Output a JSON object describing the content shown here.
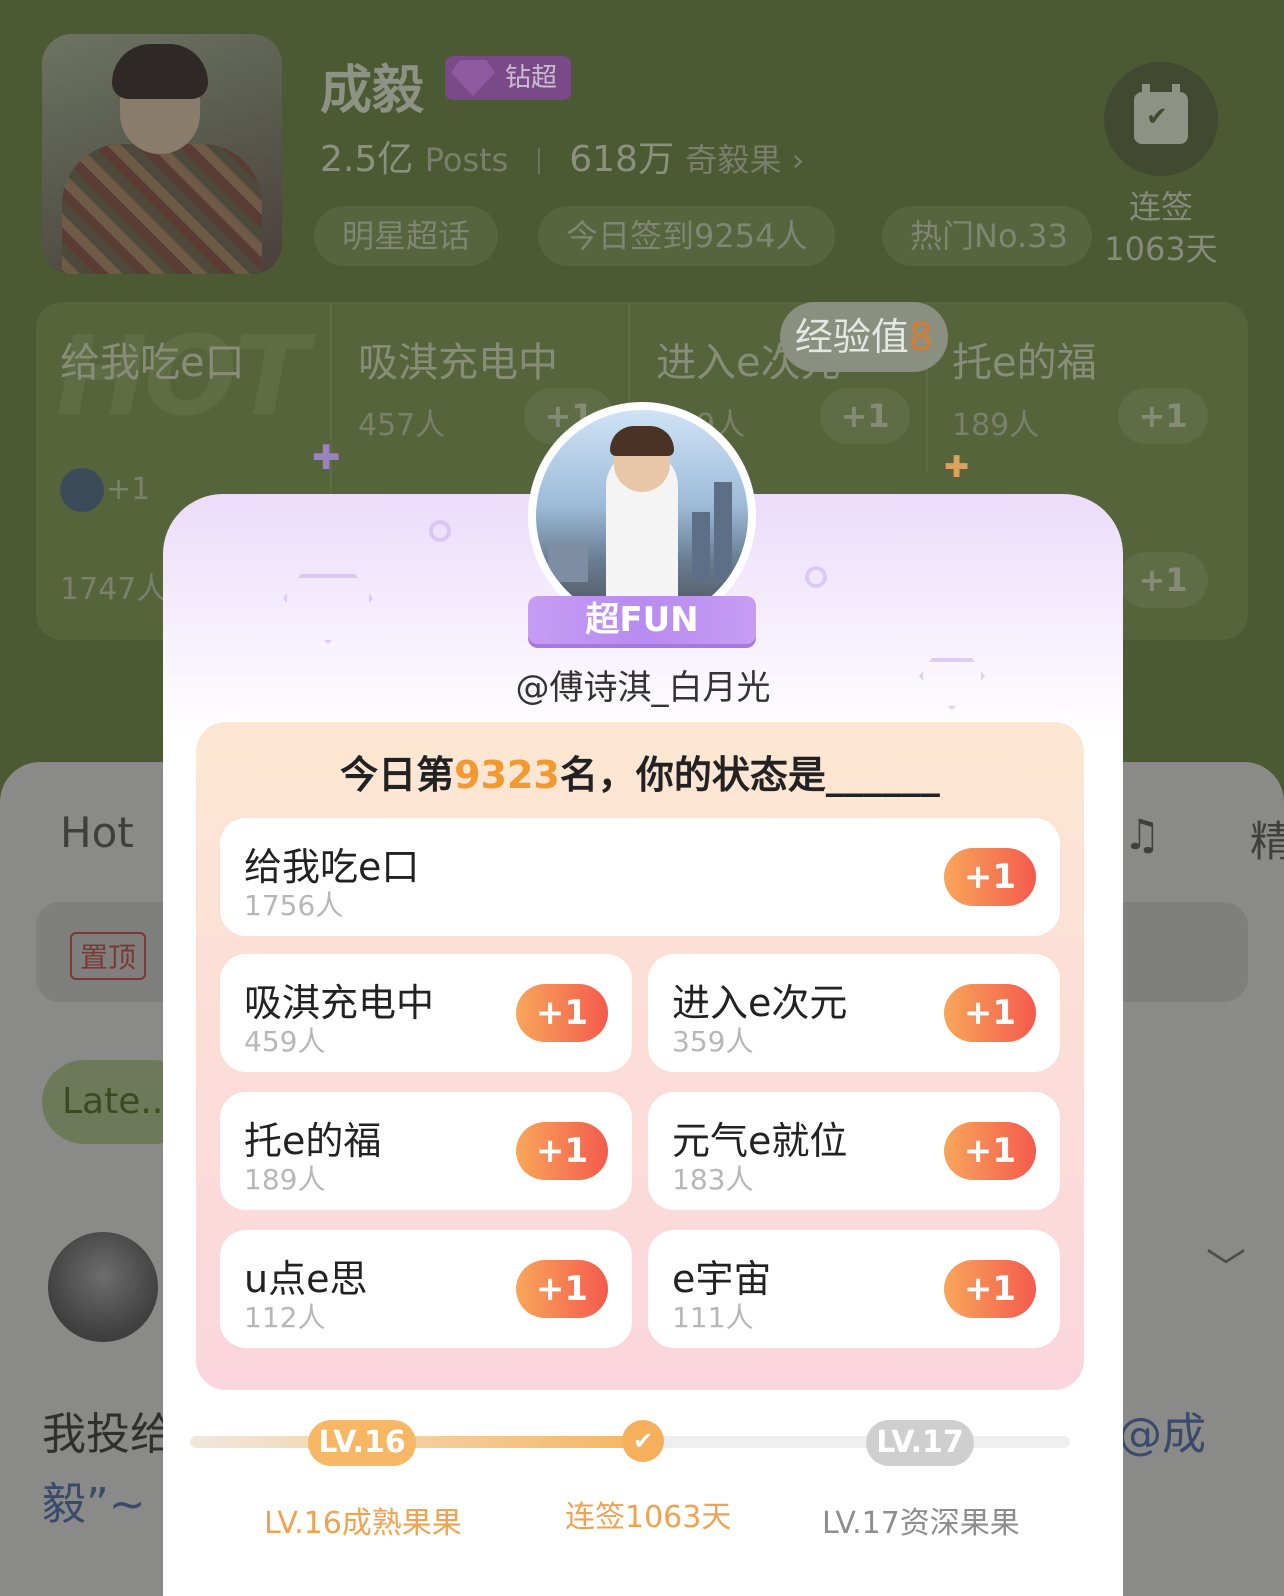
{
  "header": {
    "title": "成毅",
    "badge": "钻超",
    "stats": {
      "posts_value": "2.5亿",
      "posts_label": "Posts",
      "fans_value": "618万",
      "fans_label": "奇毅果",
      "fans_arrow": "›"
    },
    "pills": [
      "明星超话",
      "今日签到9254人",
      "热门No.33"
    ],
    "checkin": {
      "label": "连签",
      "days": "1063天"
    }
  },
  "background_tags": {
    "hot_mark": "HOT",
    "items": [
      {
        "label": "给我吃e口",
        "count": "1747人"
      },
      {
        "label": "吸淇充电中",
        "count": "457人"
      },
      {
        "label": "进入e次元",
        "count": "9人"
      },
      {
        "label": "托e的福",
        "count": "189人"
      }
    ],
    "plus_label": "+1",
    "avatar_plus": "+1"
  },
  "exp_toast": {
    "label": "经验值",
    "value": "8"
  },
  "feed": {
    "tab_hot": "Hot",
    "pinned": "置顶",
    "latest": "Late...",
    "post_text_1": "我投给",
    "post_text_2": "毅”~",
    "mention": "@成",
    "right_tab": "精",
    "right_icon": "c♫"
  },
  "modal": {
    "ribbon": "超FUN",
    "username": "@傅诗淇_白月光",
    "rank": {
      "prefix": "今日第",
      "number": "9323",
      "suffix": "名，你的状态是______"
    },
    "options": [
      {
        "label": "给我吃e口",
        "count": "1756人"
      },
      {
        "label": "吸淇充电中",
        "count": "459人"
      },
      {
        "label": "进入e次元",
        "count": "359人"
      },
      {
        "label": "托e的福",
        "count": "189人"
      },
      {
        "label": "元气e就位",
        "count": "183人"
      },
      {
        "label": "u点e思",
        "count": "112人"
      },
      {
        "label": "e宇宙",
        "count": "111人"
      }
    ],
    "plus_label": "+1",
    "level": {
      "current_badge": "LV.16",
      "current_name": "LV.16成熟果果",
      "streak": "连签1063天",
      "next_badge": "LV.17",
      "next_name": "LV.17资深果果",
      "progress": 0.5
    }
  },
  "colors": {
    "accent_orange": "#f29930",
    "plus_gradient_start": "#f8a65a",
    "plus_gradient_end": "#f45a4d",
    "ribbon_purple": "#b88bf0"
  }
}
